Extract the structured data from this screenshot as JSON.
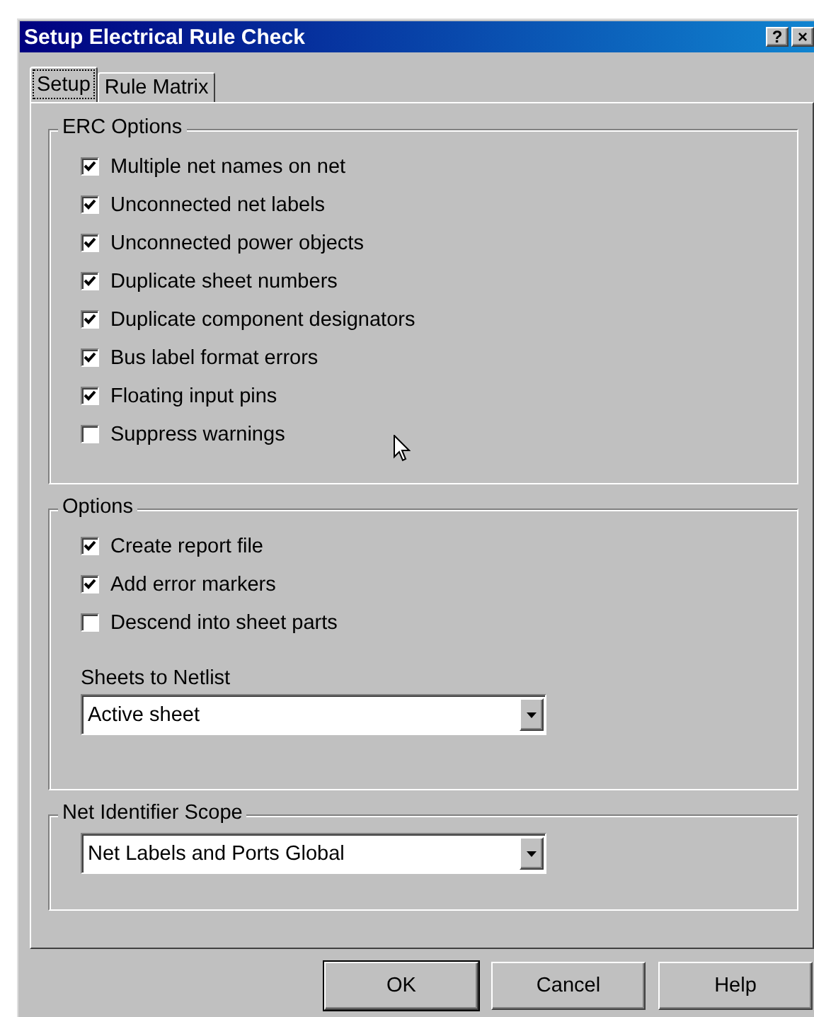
{
  "window": {
    "title": "Setup Electrical Rule Check",
    "help_button": "?",
    "close_button": "×"
  },
  "tabs": [
    {
      "label": "Setup",
      "selected": true
    },
    {
      "label": "Rule Matrix",
      "selected": false
    }
  ],
  "erc_options": {
    "title": "ERC Options",
    "items": [
      {
        "label": "Multiple net names on net",
        "checked": true
      },
      {
        "label": "Unconnected net labels",
        "checked": true
      },
      {
        "label": "Unconnected power objects",
        "checked": true
      },
      {
        "label": "Duplicate sheet numbers",
        "checked": true
      },
      {
        "label": "Duplicate component designators",
        "checked": true
      },
      {
        "label": "Bus label format errors",
        "checked": true
      },
      {
        "label": "Floating input pins",
        "checked": true
      },
      {
        "label": "Suppress warnings",
        "checked": false
      }
    ]
  },
  "options": {
    "title": "Options",
    "items": [
      {
        "label": "Create report file",
        "checked": true
      },
      {
        "label": "Add error markers",
        "checked": true
      },
      {
        "label": "Descend into sheet parts",
        "checked": false
      }
    ],
    "sheets_to_netlist": {
      "label": "Sheets to Netlist",
      "value": "Active sheet"
    }
  },
  "net_identifier_scope": {
    "title": "Net Identifier Scope",
    "value": "Net Labels and Ports Global"
  },
  "buttons": [
    "OK",
    "Cancel",
    "Help"
  ]
}
